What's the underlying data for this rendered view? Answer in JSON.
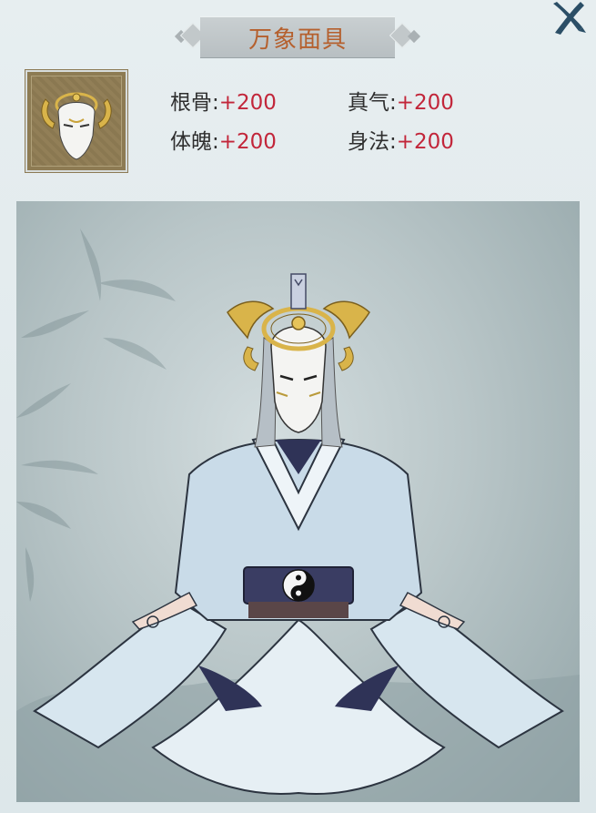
{
  "item": {
    "title": "万象面具",
    "icon": "white-mask-with-gold-crown-icon"
  },
  "stats": [
    {
      "label": "根骨",
      "sep": ":",
      "value": "+200"
    },
    {
      "label": "真气",
      "sep": ":",
      "value": "+200"
    },
    {
      "label": "体魄",
      "sep": ":",
      "value": "+200"
    },
    {
      "label": "身法",
      "sep": ":",
      "value": "+200"
    }
  ],
  "close_icon": "close-x-icon",
  "portrait": {
    "subject": "character-wearing-mask-illustration"
  },
  "colors": {
    "title": "#b5602e",
    "stat_value": "#c2263a",
    "stat_label": "#2f2f2f",
    "close": "#2b4e66"
  }
}
